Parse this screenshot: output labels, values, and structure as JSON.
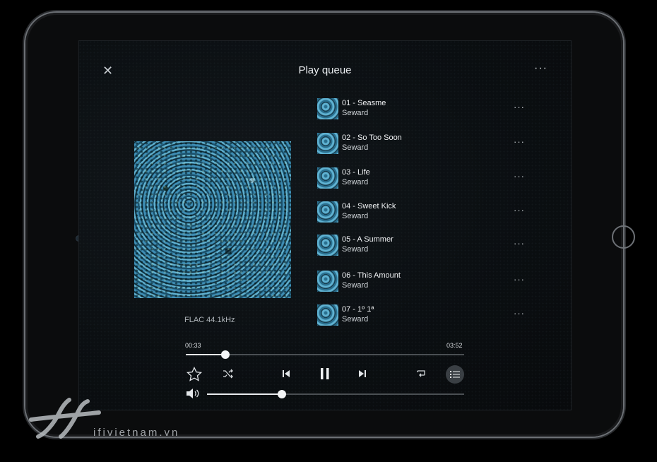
{
  "header": {
    "close_label": "✕",
    "title": "Play queue",
    "more_label": "···"
  },
  "now_playing": {
    "format": "FLAC 44.1kHz"
  },
  "queue": [
    {
      "title": "01 - Seasme",
      "artist": "Seward"
    },
    {
      "title": "02 - So Too Soon",
      "artist": "Seward"
    },
    {
      "title": "03 - Life",
      "artist": "Seward"
    },
    {
      "title": "04 - Sweet Kick",
      "artist": "Seward"
    },
    {
      "title": "05 - A Summer",
      "artist": "Seward"
    },
    {
      "title": "06 - This Amount",
      "artist": "Seward"
    },
    {
      "title": "07 - 1º 1ª",
      "artist": "Seward"
    }
  ],
  "row_more_label": "···",
  "progress": {
    "elapsed": "00:33",
    "total": "03:52",
    "fraction": 0.1422
  },
  "volume": {
    "fraction": 0.29
  },
  "controls": {
    "favorite_icon": "star-outline-icon",
    "shuffle_icon": "shuffle-icon",
    "previous_icon": "skip-previous-icon",
    "pause_icon": "pause-icon",
    "next_icon": "skip-next-icon",
    "repeat_icon": "repeat-icon",
    "queue_icon": "queue-list-icon",
    "volume_icon": "speaker-icon"
  },
  "watermark": {
    "text": "ifivietnam.vn"
  },
  "colors": {
    "accent": "#e9ecef",
    "background": "#0b0f12",
    "track": "#4a4f53"
  }
}
